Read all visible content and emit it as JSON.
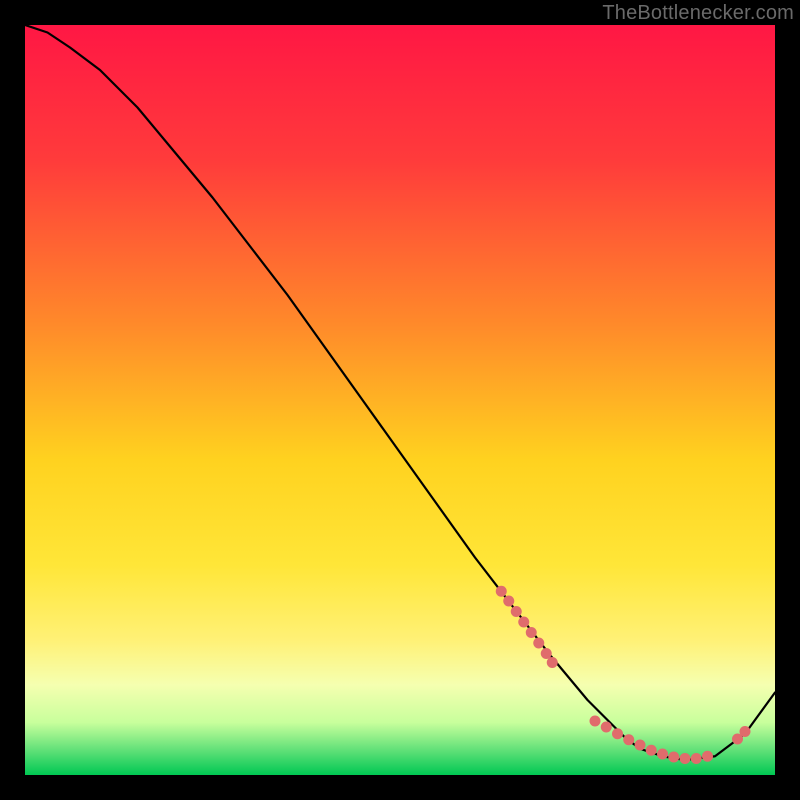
{
  "watermark": "TheBottlenecker.com",
  "chart_data": {
    "type": "line",
    "title": "",
    "xlabel": "",
    "ylabel": "",
    "xlim": [
      0,
      100
    ],
    "ylim": [
      0,
      100
    ],
    "gradient_stops": [
      {
        "offset": 0,
        "color": "#ff1744"
      },
      {
        "offset": 0.18,
        "color": "#ff3b3b"
      },
      {
        "offset": 0.4,
        "color": "#ff8a2a"
      },
      {
        "offset": 0.58,
        "color": "#ffd21f"
      },
      {
        "offset": 0.72,
        "color": "#ffe638"
      },
      {
        "offset": 0.82,
        "color": "#fff176"
      },
      {
        "offset": 0.88,
        "color": "#f5ffb0"
      },
      {
        "offset": 0.93,
        "color": "#c8ff9c"
      },
      {
        "offset": 0.965,
        "color": "#66e27a"
      },
      {
        "offset": 1.0,
        "color": "#00c853"
      }
    ],
    "series": [
      {
        "name": "curve",
        "color": "#000000",
        "x": [
          0,
          3,
          6,
          10,
          15,
          20,
          25,
          30,
          35,
          40,
          45,
          50,
          55,
          60,
          65,
          70,
          75,
          78,
          80,
          82,
          85,
          88,
          92,
          96,
          100
        ],
        "y": [
          100,
          99,
          97,
          94,
          89,
          83,
          77,
          70.5,
          64,
          57,
          50,
          43,
          36,
          29,
          22.5,
          16,
          10,
          7,
          5,
          3.5,
          2.5,
          2,
          2.5,
          5.5,
          11
        ]
      }
    ],
    "markers": {
      "color": "#e06c6c",
      "clusters": [
        {
          "note": "upper-diagonal dashed segment",
          "points": [
            {
              "x": 63.5,
              "y": 24.5
            },
            {
              "x": 64.5,
              "y": 23.2
            },
            {
              "x": 65.5,
              "y": 21.8
            },
            {
              "x": 66.5,
              "y": 20.4
            },
            {
              "x": 67.5,
              "y": 19.0
            },
            {
              "x": 68.5,
              "y": 17.6
            },
            {
              "x": 69.5,
              "y": 16.2
            },
            {
              "x": 70.3,
              "y": 15.0
            }
          ]
        },
        {
          "note": "flat-bottom dashed segment",
          "points": [
            {
              "x": 76.0,
              "y": 7.2
            },
            {
              "x": 77.5,
              "y": 6.4
            },
            {
              "x": 79.0,
              "y": 5.5
            },
            {
              "x": 80.5,
              "y": 4.7
            },
            {
              "x": 82.0,
              "y": 4.0
            },
            {
              "x": 83.5,
              "y": 3.3
            },
            {
              "x": 85.0,
              "y": 2.8
            },
            {
              "x": 86.5,
              "y": 2.4
            },
            {
              "x": 88.0,
              "y": 2.2
            },
            {
              "x": 89.5,
              "y": 2.2
            },
            {
              "x": 91.0,
              "y": 2.5
            }
          ]
        },
        {
          "note": "right-side uptick dashes",
          "points": [
            {
              "x": 95.0,
              "y": 4.8
            },
            {
              "x": 96.0,
              "y": 5.8
            }
          ]
        }
      ]
    }
  }
}
